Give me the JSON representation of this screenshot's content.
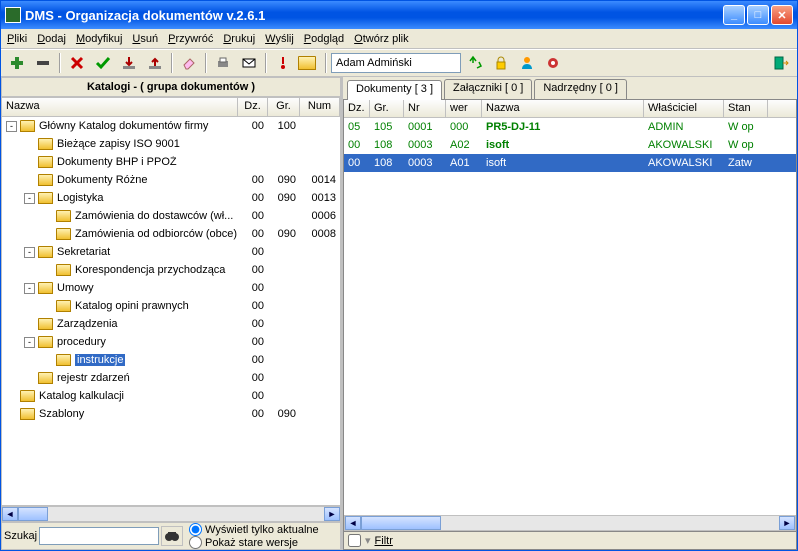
{
  "title": "DMS - Organizacja dokumentów v.2.6.1",
  "menus": [
    "Pliki",
    "Dodaj",
    "Modyfikuj",
    "Usuń",
    "Przywróć",
    "Drukuj",
    "Wyślij",
    "Podgląd",
    "Otwórz plik"
  ],
  "user": "Adam Admiński",
  "left": {
    "header": "Katalogi - ( grupa dokumentów )",
    "cols": {
      "nazwa": "Nazwa",
      "dz": "Dz.",
      "gr": "Gr.",
      "num": "Num"
    },
    "search_label": "Szukaj",
    "radio1": "Wyświetl tylko aktualne",
    "radio2": "Pokaż stare wersje"
  },
  "tree": [
    {
      "indent": 0,
      "exp": "-",
      "label": "Główny Katalog dokumentów firmy",
      "dz": "00",
      "gr": "100",
      "num": ""
    },
    {
      "indent": 1,
      "exp": "",
      "label": "Bieżące zapisy ISO 9001",
      "dz": "",
      "gr": "",
      "num": ""
    },
    {
      "indent": 1,
      "exp": "",
      "label": "Dokumenty BHP i PPOŻ",
      "dz": "",
      "gr": "",
      "num": ""
    },
    {
      "indent": 1,
      "exp": "",
      "label": "Dokumenty Różne",
      "dz": "00",
      "gr": "090",
      "num": "0014"
    },
    {
      "indent": 1,
      "exp": "-",
      "label": "Logistyka",
      "dz": "00",
      "gr": "090",
      "num": "0013"
    },
    {
      "indent": 2,
      "exp": "",
      "label": "Zamówienia do dostawców (wł...",
      "dz": "00",
      "gr": "",
      "num": "0006"
    },
    {
      "indent": 2,
      "exp": "",
      "label": "Zamówienia od odbiorców (obce)",
      "dz": "00",
      "gr": "090",
      "num": "0008"
    },
    {
      "indent": 1,
      "exp": "-",
      "label": "Sekretariat",
      "dz": "00",
      "gr": "",
      "num": ""
    },
    {
      "indent": 2,
      "exp": "",
      "label": "Korespondencja przychodząca",
      "dz": "00",
      "gr": "",
      "num": ""
    },
    {
      "indent": 1,
      "exp": "-",
      "label": "Umowy",
      "dz": "00",
      "gr": "",
      "num": ""
    },
    {
      "indent": 2,
      "exp": "",
      "label": "Katalog opini prawnych",
      "dz": "00",
      "gr": "",
      "num": ""
    },
    {
      "indent": 1,
      "exp": "",
      "label": "Zarządzenia",
      "dz": "00",
      "gr": "",
      "num": ""
    },
    {
      "indent": 1,
      "exp": "-",
      "label": "procedury",
      "dz": "00",
      "gr": "",
      "num": ""
    },
    {
      "indent": 2,
      "exp": "",
      "label": "instrukcje",
      "dz": "00",
      "gr": "",
      "num": "",
      "selected": true
    },
    {
      "indent": 1,
      "exp": "",
      "label": "rejestr zdarzeń",
      "dz": "00",
      "gr": "",
      "num": ""
    },
    {
      "indent": 0,
      "exp": "",
      "label": "Katalog kalkulacji",
      "dz": "00",
      "gr": "",
      "num": ""
    },
    {
      "indent": 0,
      "exp": "",
      "label": "Szablony",
      "dz": "00",
      "gr": "090",
      "num": ""
    }
  ],
  "tabs": [
    {
      "label": "Dokumenty [ 3 ]",
      "active": true
    },
    {
      "label": "Załączniki [ 0 ]",
      "active": false
    },
    {
      "label": "Nadrzędny [ 0 ]",
      "active": false
    }
  ],
  "grid": {
    "cols": {
      "dz": "Dz.",
      "gr": "Gr.",
      "nr": "Nr",
      "wer": "wer",
      "nazwa": "Nazwa",
      "wlasc": "Właściciel",
      "stan": "Stan"
    },
    "rows": [
      {
        "dz": "05",
        "gr": "105",
        "nr": "0001",
        "wer": "000",
        "nazwa": "PR5-DJ-11",
        "wlasc": "ADMIN",
        "stan": "W op",
        "sel": false
      },
      {
        "dz": "00",
        "gr": "108",
        "nr": "0003",
        "wer": "A02",
        "nazwa": "isoft",
        "wlasc": "AKOWALSKI",
        "stan": "W op",
        "sel": false
      },
      {
        "dz": "00",
        "gr": "108",
        "nr": "0003",
        "wer": "A01",
        "nazwa": "isoft",
        "wlasc": "AKOWALSKI",
        "stan": "Zatw",
        "sel": true
      }
    ]
  },
  "filter_label": "Filtr"
}
